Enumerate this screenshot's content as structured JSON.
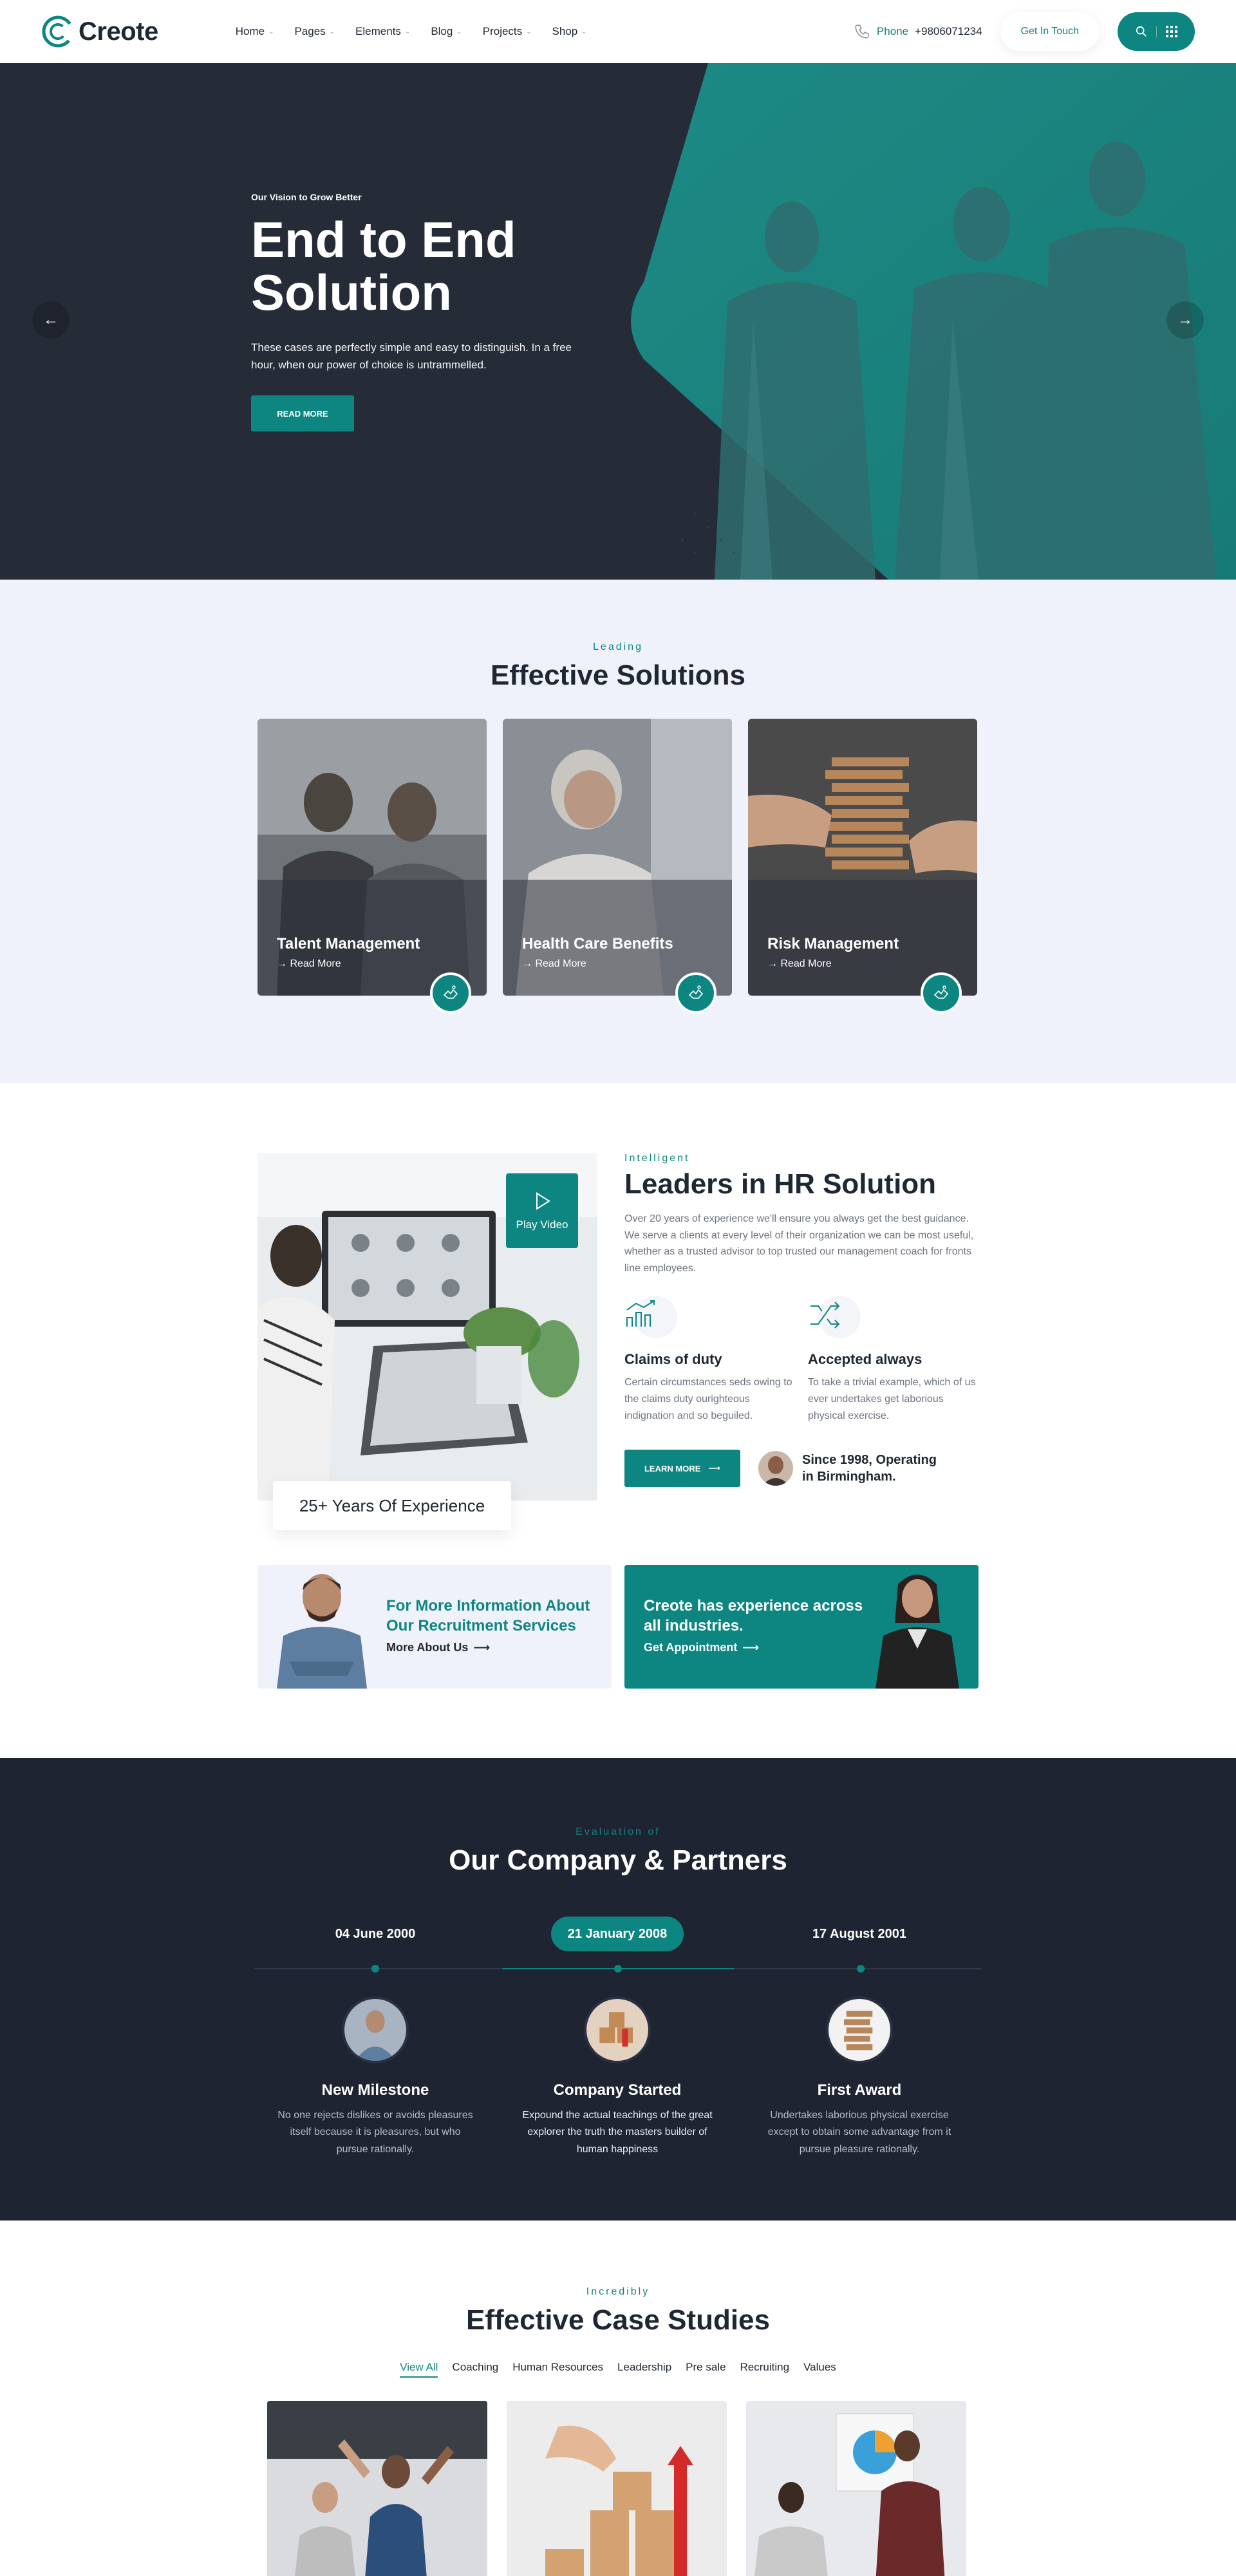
{
  "header": {
    "logo_text": "Creote",
    "nav": [
      "Home",
      "Pages",
      "Elements",
      "Blog",
      "Projects",
      "Shop"
    ],
    "phone_label": "Phone",
    "phone_number": "+9806071234",
    "cta_label": "Get In Touch",
    "icons": [
      "search-icon",
      "grid-menu-icon"
    ]
  },
  "hero": {
    "eyebrow": "Our Vision to Grow Better",
    "title_line1": "End to End",
    "title_line2": "Solution",
    "description_line1": "These cases are perfectly simple and easy to distinguish. In a free",
    "description_line2": "hour, when our power of choice is untrammelled.",
    "button": "READ MORE",
    "prev_arrow": "←",
    "next_arrow": "→"
  },
  "solutions": {
    "eyebrow": "Leading",
    "title": "Effective Solutions",
    "cards": [
      {
        "title": "Talent Management",
        "link": "→ Read More"
      },
      {
        "title": "Health Care Benefits",
        "link": "→ Read More"
      },
      {
        "title": "Risk Management",
        "link": "→ Read More"
      }
    ]
  },
  "hr": {
    "play_label": "Play Video",
    "years_label": "25+ Years Of Experience",
    "eyebrow": "Intelligent",
    "title": "Leaders in HR Solution",
    "description": "Over 20 years of experience we'll ensure you always get the best guidance. We serve a clients at every level of their organization we can be most useful, whether as a trusted advisor to top trusted our management coach for fronts line employees.",
    "features": [
      {
        "title": "Claims of duty",
        "desc": "Certain circumstances seds owing to the claims duty ourighteous indignation and so beguiled."
      },
      {
        "title": "Accepted always",
        "desc": "To take a trivial example, which of us ever undertakes get laborious physical exercise."
      }
    ],
    "button": "LEARN MORE",
    "since_line1": "Since 1998, Operating",
    "since_line2": "in Birmingham."
  },
  "promos": [
    {
      "title_line1": "For More Information About",
      "title_line2": "Our Recruitment Services",
      "link": "More About Us"
    },
    {
      "title_line1": "Creote has experience across",
      "title_line2": "all industries.",
      "link": "Get Appointment"
    }
  ],
  "company": {
    "eyebrow": "Evaluation of",
    "title": "Our Company & Partners",
    "dates": [
      "04 June 2000",
      "21 January 2008",
      "17 August 2001"
    ],
    "events": [
      {
        "title": "New Milestone",
        "desc": "No one rejects dislikes or avoids pleasures itself because it is pleasures, but who pursue rationally."
      },
      {
        "title": "Company Started",
        "desc": "Expound the actual teachings of the great explorer the truth the masters builder of human happiness"
      },
      {
        "title": "First Award",
        "desc": "Undertakes laborious physical exercise except to obtain some advantage from it pursue pleasure rationally."
      }
    ]
  },
  "cases": {
    "eyebrow": "Incredibly",
    "title": "Effective Case Studies",
    "filters": [
      "View All",
      "Coaching",
      "Human Resources",
      "Leadership",
      "Pre sale",
      "Recruiting",
      "Values"
    ]
  },
  "colors": {
    "accent": "#0d8682",
    "dark": "#262b38",
    "dark2": "#1f2432",
    "light_bg": "#f0f2fb"
  }
}
